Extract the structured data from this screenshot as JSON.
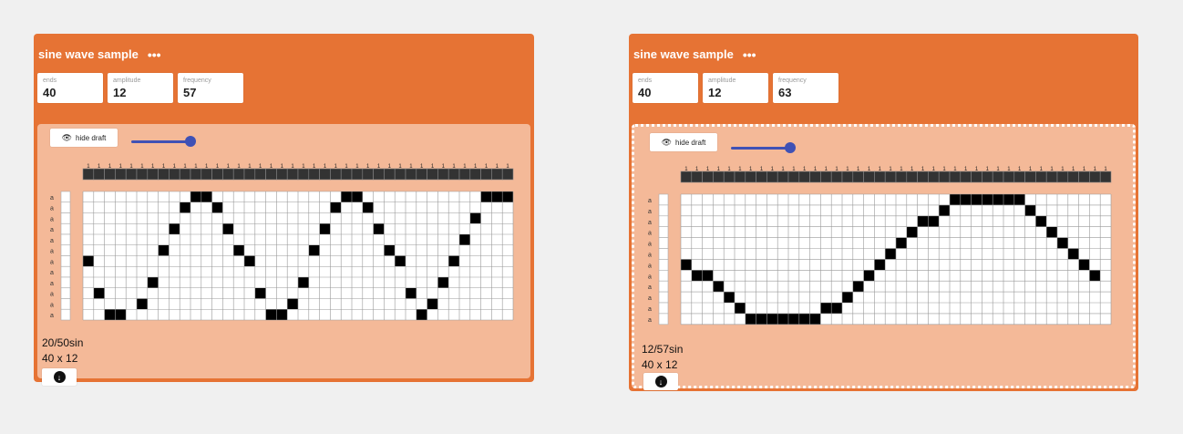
{
  "cards": [
    {
      "title": "sine wave sample",
      "menu_glyph": "•••",
      "params": [
        {
          "label": "ends",
          "value": "40"
        },
        {
          "label": "amplitude",
          "value": "12"
        },
        {
          "label": "frequency",
          "value": "57"
        }
      ],
      "hide_draft_label": "hide draft",
      "slider_level": 1.0,
      "caption_line1": "20/50sin",
      "caption_line2": "40 x 12",
      "draft": {
        "cols": 40,
        "rows": 12,
        "warp_label": "1",
        "weft_label": "a",
        "cells": [
          [
            10,
            0
          ],
          [
            11,
            0
          ],
          [
            24,
            0
          ],
          [
            25,
            0
          ],
          [
            37,
            0
          ],
          [
            38,
            0
          ],
          [
            39,
            0
          ],
          [
            9,
            1
          ],
          [
            12,
            1
          ],
          [
            23,
            1
          ],
          [
            26,
            1
          ],
          [
            36,
            2
          ],
          [
            8,
            3
          ],
          [
            13,
            3
          ],
          [
            22,
            3
          ],
          [
            27,
            3
          ],
          [
            35,
            4
          ],
          [
            7,
            5
          ],
          [
            14,
            5
          ],
          [
            21,
            5
          ],
          [
            28,
            5
          ],
          [
            0,
            6
          ],
          [
            15,
            6
          ],
          [
            29,
            6
          ],
          [
            34,
            6
          ],
          [
            6,
            8
          ],
          [
            20,
            8
          ],
          [
            33,
            8
          ],
          [
            1,
            9
          ],
          [
            16,
            9
          ],
          [
            30,
            9
          ],
          [
            5,
            10
          ],
          [
            19,
            10
          ],
          [
            32,
            10
          ],
          [
            2,
            11
          ],
          [
            3,
            11
          ],
          [
            17,
            11
          ],
          [
            18,
            11
          ],
          [
            31,
            11
          ]
        ]
      }
    },
    {
      "title": "sine wave sample",
      "menu_glyph": "•••",
      "params": [
        {
          "label": "ends",
          "value": "40"
        },
        {
          "label": "amplitude",
          "value": "12"
        },
        {
          "label": "frequency",
          "value": "63"
        }
      ],
      "hide_draft_label": "hide draft",
      "slider_level": 1.0,
      "caption_line1": "12/57sin",
      "caption_line2": "40 x 12",
      "draft": {
        "cols": 40,
        "rows": 12,
        "warp_label": "1",
        "weft_label": "a",
        "cells": [
          [
            25,
            0
          ],
          [
            26,
            0
          ],
          [
            27,
            0
          ],
          [
            28,
            0
          ],
          [
            29,
            0
          ],
          [
            30,
            0
          ],
          [
            31,
            0
          ],
          [
            24,
            1
          ],
          [
            32,
            1
          ],
          [
            22,
            2
          ],
          [
            23,
            2
          ],
          [
            33,
            2
          ],
          [
            21,
            3
          ],
          [
            34,
            3
          ],
          [
            20,
            4
          ],
          [
            35,
            4
          ],
          [
            19,
            5
          ],
          [
            36,
            5
          ],
          [
            0,
            6
          ],
          [
            18,
            6
          ],
          [
            37,
            6
          ],
          [
            1,
            7
          ],
          [
            2,
            7
          ],
          [
            17,
            7
          ],
          [
            38,
            7
          ],
          [
            3,
            8
          ],
          [
            16,
            8
          ],
          [
            4,
            9
          ],
          [
            15,
            9
          ],
          [
            5,
            10
          ],
          [
            13,
            10
          ],
          [
            14,
            10
          ],
          [
            6,
            11
          ],
          [
            7,
            11
          ],
          [
            8,
            11
          ],
          [
            9,
            11
          ],
          [
            10,
            11
          ],
          [
            11,
            11
          ],
          [
            12,
            11
          ]
        ]
      }
    }
  ]
}
